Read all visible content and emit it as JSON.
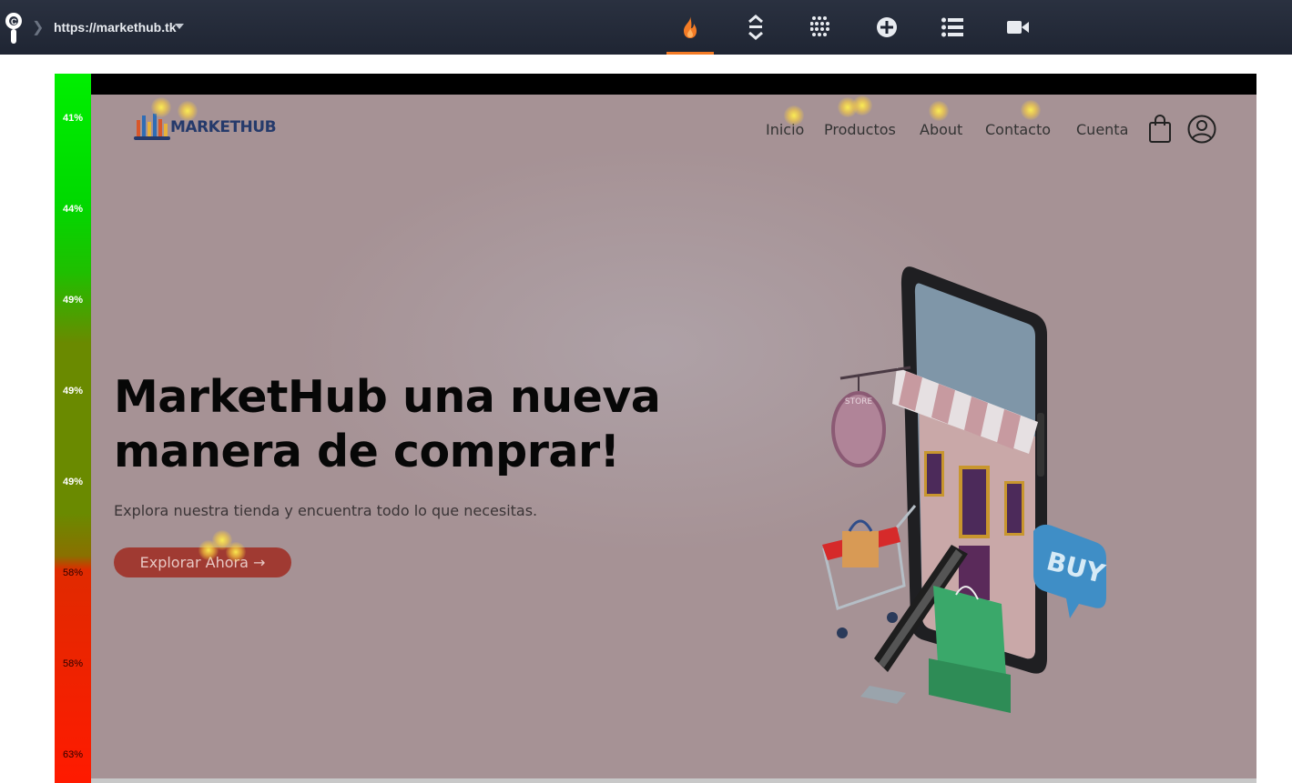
{
  "toolbar": {
    "url": "https://markethub.tk",
    "tools": [
      {
        "name": "heatmap-icon",
        "active": true
      },
      {
        "name": "scroll-map-icon",
        "active": false
      },
      {
        "name": "click-grid-icon",
        "active": false
      },
      {
        "name": "add-icon",
        "active": false
      },
      {
        "name": "list-icon",
        "active": false
      },
      {
        "name": "video-icon",
        "active": false
      }
    ],
    "accent_color": "#f47b25"
  },
  "scroll_map": {
    "labels": [
      "41%",
      "44%",
      "49%",
      "49%",
      "49%",
      "58%",
      "58%",
      "63%"
    ]
  },
  "site": {
    "logo_text": "MARKETHUB",
    "nav": [
      "Inicio",
      "Productos",
      "About",
      "Contacto",
      "Cuenta"
    ],
    "hero": {
      "title": "MarketHub una nueva manera de comprar!",
      "subtitle": "Explora nuestra tienda y encuentra todo lo que necesitas.",
      "cta": "Explorar Ahora →"
    },
    "illustration": {
      "store_sign": "STORE",
      "bubble": "BUY"
    },
    "colors": {
      "cta": "#a03a32",
      "title": "#070707",
      "logo": "#253a6b"
    }
  }
}
